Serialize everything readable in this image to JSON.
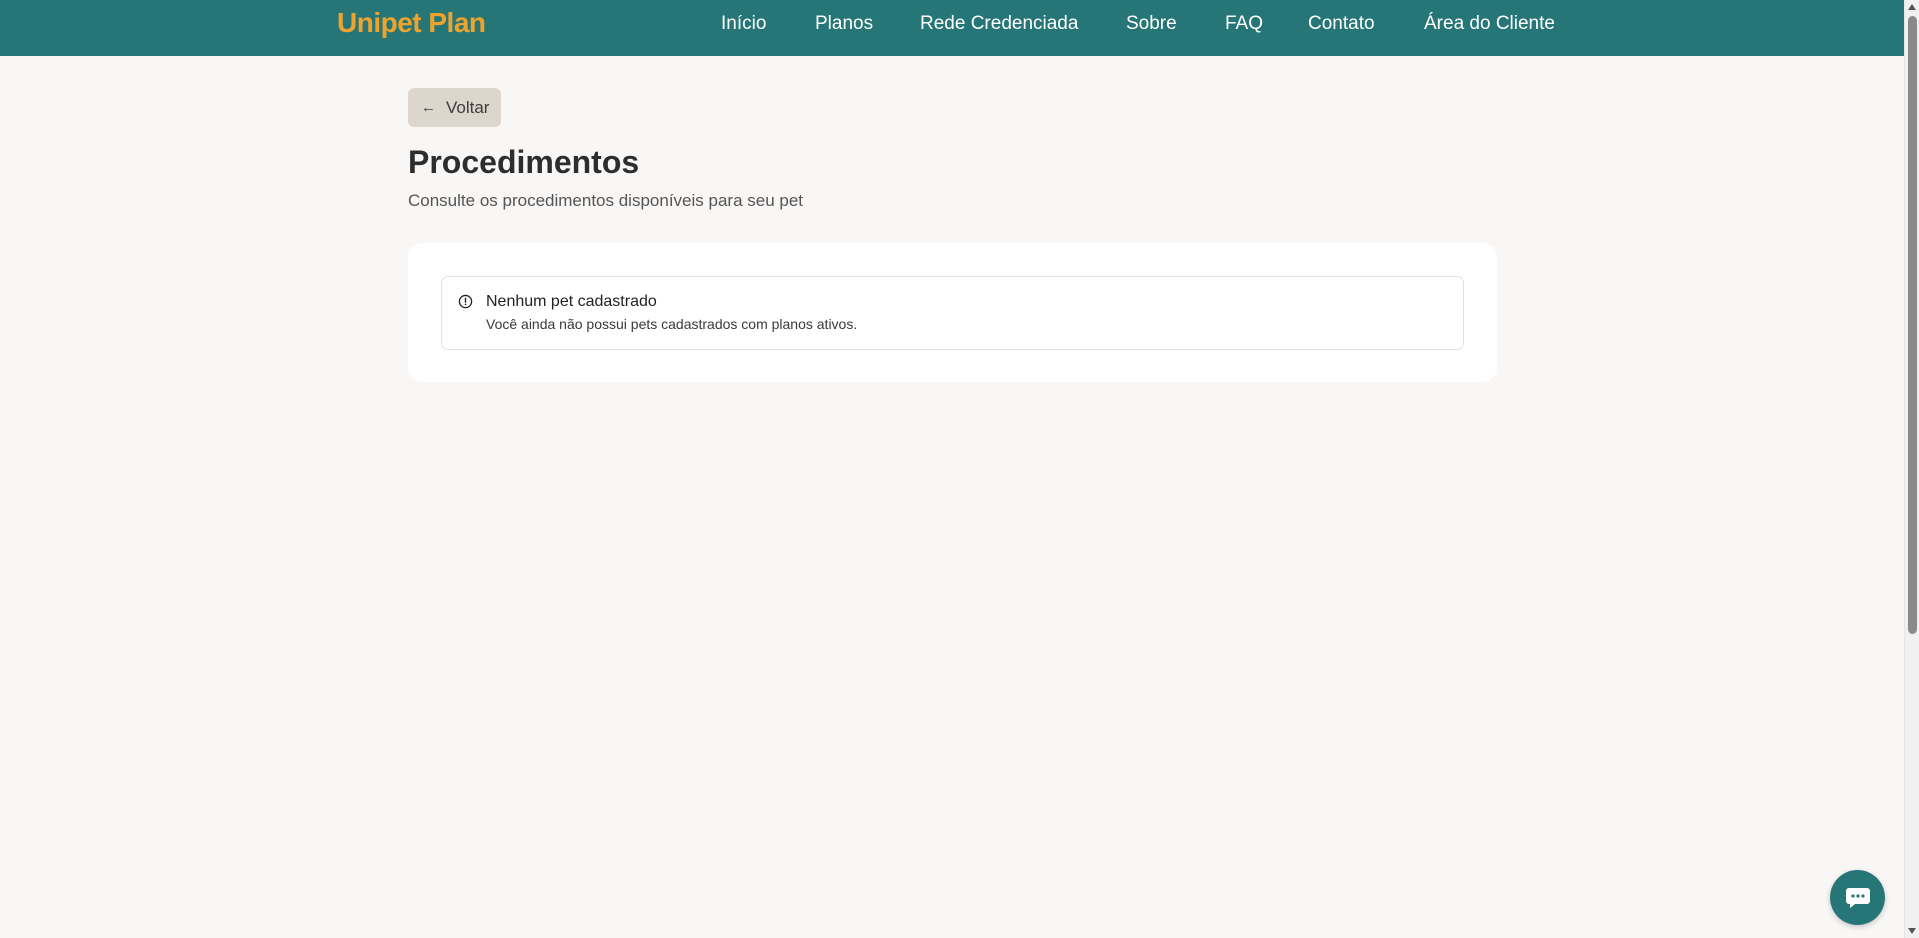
{
  "navbar": {
    "logo": "Unipet Plan",
    "links": [
      "Início",
      "Planos",
      "Rede Credenciada",
      "Sobre",
      "FAQ",
      "Contato",
      "Área do Cliente"
    ]
  },
  "back_button": {
    "label": "Voltar",
    "icon": "arrow-left-icon"
  },
  "page": {
    "title": "Procedimentos",
    "subtitle": "Consulte os procedimentos disponíveis para seu pet"
  },
  "alert": {
    "icon": "alert-circle-icon",
    "title": "Nenhum pet cadastrado",
    "description": "Você ainda não possui pets cadastrados com planos ativos."
  },
  "chat": {
    "icon": "chat-icon"
  },
  "colors": {
    "brand": "#277677",
    "logo": "#f0a32c",
    "background": "#f9f7f5",
    "back_button_bg": "#ddd6cc"
  }
}
